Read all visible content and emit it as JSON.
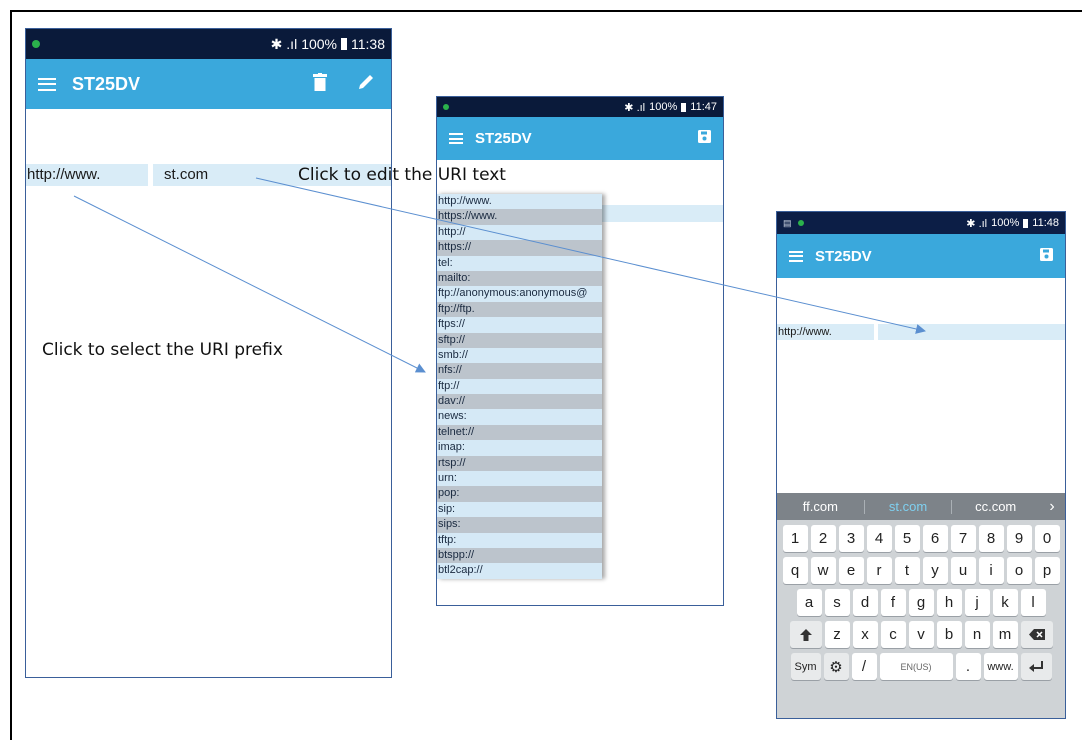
{
  "phone1": {
    "status": {
      "signal": "✱ .ıl",
      "battery": "100%",
      "time": "11:38"
    },
    "appbar": {
      "title": "ST25DV"
    },
    "prefix": "http://www.",
    "uri": "st.com"
  },
  "phone2": {
    "status": {
      "signal": "✱ .ıl",
      "battery": "100%",
      "time": "11:47"
    },
    "appbar": {
      "title": "ST25DV"
    },
    "prefixes": [
      "http://www.",
      "https://www.",
      "http://",
      "https://",
      "tel:",
      "mailto:",
      "ftp://anonymous:anonymous@",
      "ftp://ftp.",
      "ftps://",
      "sftp://",
      "smb://",
      "nfs://",
      "ftp://",
      "dav://",
      "news:",
      "telnet://",
      "imap:",
      "rtsp://",
      "urn:",
      "pop:",
      "sip:",
      "sips:",
      "tftp:",
      "btspp://",
      "btl2cap://"
    ]
  },
  "phone3": {
    "status": {
      "signal": "✱ .ıl",
      "battery": "100%",
      "time": "11:48"
    },
    "appbar": {
      "title": "ST25DV"
    },
    "prefix": "http://www.",
    "keyboard": {
      "suggestions": [
        "ff.com",
        "st.com",
        "cc.com"
      ],
      "more": "›",
      "row1": [
        "1",
        "2",
        "3",
        "4",
        "5",
        "6",
        "7",
        "8",
        "9",
        "0"
      ],
      "row2": [
        "q",
        "w",
        "e",
        "r",
        "t",
        "y",
        "u",
        "i",
        "o",
        "p"
      ],
      "row3": [
        "a",
        "s",
        "d",
        "f",
        "g",
        "h",
        "j",
        "k",
        "l"
      ],
      "row4": [
        "z",
        "x",
        "c",
        "v",
        "b",
        "n",
        "m"
      ],
      "sym": "Sym",
      "slash": "/",
      "space": "EN(US)",
      "dot": ".",
      "www": "www."
    }
  },
  "notes": {
    "edit": "Click to edit the URI text",
    "select": "Click to select the URI prefix"
  }
}
